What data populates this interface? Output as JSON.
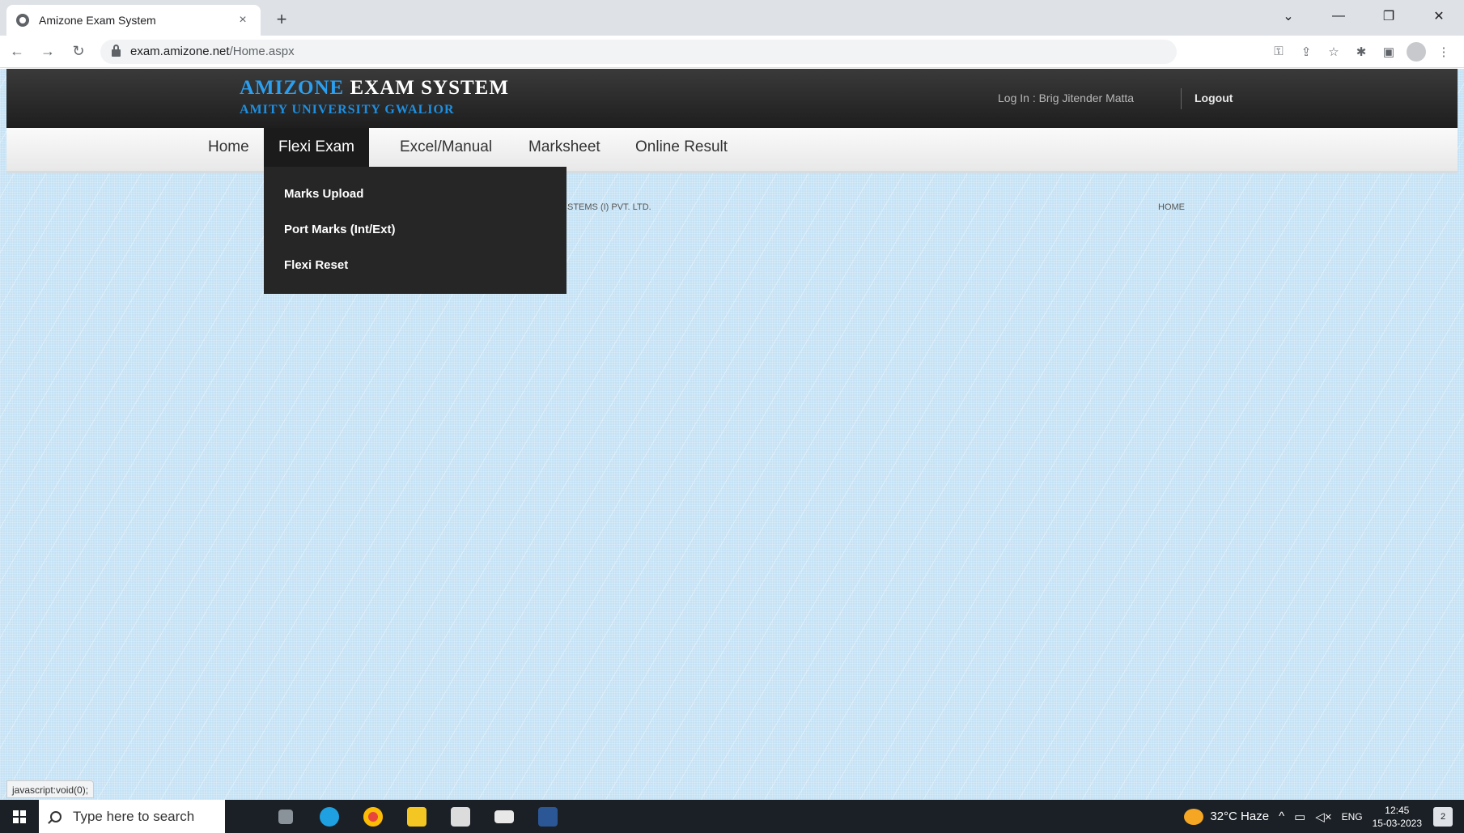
{
  "browser": {
    "tab_title": "Amizone Exam System",
    "tab_close": "×",
    "new_tab": "+",
    "url_host": "exam.amizone.net",
    "url_path": "/Home.aspx",
    "status_url": "javascript:void(0);"
  },
  "header": {
    "title_highlight": "AMIZONE",
    "title_rest": " EXAM SYSTEM",
    "subtitle": "AMITY UNIVERSITY GWALIOR",
    "login_info": "Log In : Brig Jitender Matta",
    "logout": "Logout"
  },
  "menu": {
    "items": [
      "Home",
      "Flexi Exam",
      "Excel/Manual",
      "Marksheet",
      "Online Result"
    ],
    "active": "Flexi Exam",
    "dropdown": [
      "Marks Upload",
      "Port Marks (Int/Ext)",
      "Flexi Reset"
    ]
  },
  "footer": {
    "left_text": "STEMS (I) PVT. LTD.",
    "right_text": "HOME"
  },
  "taskbar": {
    "search_placeholder": "Type here to search",
    "weather": "32°C Haze",
    "language": "ENG",
    "time": "12:45",
    "date": "15-03-2023",
    "notification_count": "2"
  }
}
